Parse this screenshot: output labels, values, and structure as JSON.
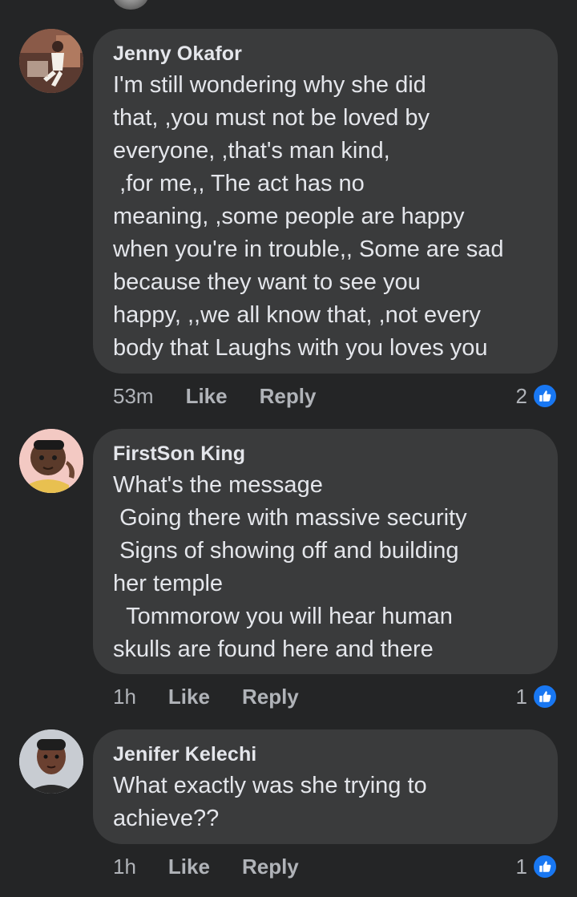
{
  "comments": [
    {
      "author": "Jenny Okafor",
      "text": "I'm still wondering why she did\nthat, ,you must not be loved by\neveryone, ,that's man kind,\n ,for me,, The act has no\nmeaning, ,some people are happy\nwhen you're in trouble,, Some are sad\nbecause they want to see you\nhappy, ,,we all know that, ,not every\nbody that Laughs with you loves you",
      "time": "53m",
      "like_label": "Like",
      "reply_label": "Reply",
      "reaction_count": "2"
    },
    {
      "author": "FirstSon King",
      "text": "What's the message\n Going there with massive security\n Signs of showing off and building\nher temple\n  Tommorow you will hear human\nskulls are found here and there",
      "time": "1h",
      "like_label": "Like",
      "reply_label": "Reply",
      "reaction_count": "1"
    },
    {
      "author": "Jenifer Kelechi",
      "text": "What exactly was she trying to\nachieve??",
      "time": "1h",
      "like_label": "Like",
      "reply_label": "Reply",
      "reaction_count": "1"
    }
  ],
  "colors": {
    "background": "#242526",
    "bubble": "#3a3b3c",
    "text": "#e4e6eb",
    "secondary_text": "#b0b3b8",
    "like_blue": "#1877f2"
  },
  "icons": {
    "reaction": "thumbs-up-icon"
  }
}
